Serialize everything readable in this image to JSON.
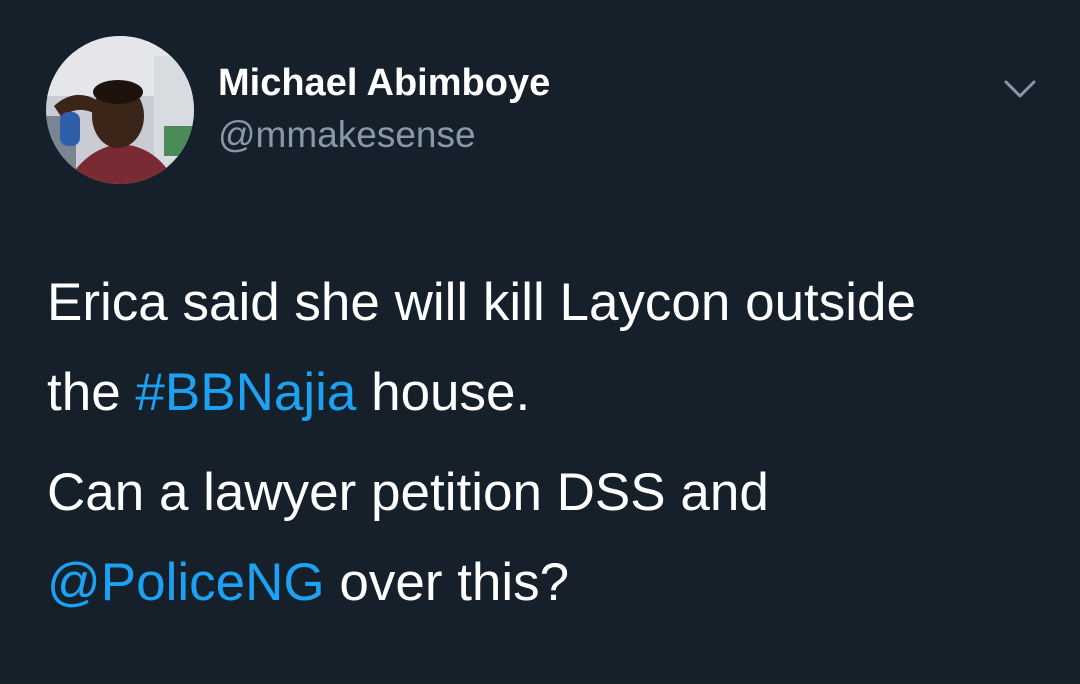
{
  "tweet": {
    "author": {
      "name": "Michael Abimboye",
      "handle": "@mmakesense",
      "avatar_icon": "profile-photo"
    },
    "menu_icon": "chevron-down-icon",
    "paragraph1": {
      "text_a": "Erica said she will kill Laycon outside",
      "text_b": "the ",
      "hashtag": "#BBNajia",
      "text_c": " house."
    },
    "paragraph2": {
      "text_a": "Can a lawyer petition DSS and",
      "mention": "@PoliceNG",
      "text_b": " over this?"
    }
  },
  "colors": {
    "background": "#15202b",
    "text": "#ffffff",
    "secondary": "#8899a6",
    "link": "#1da1f2"
  }
}
